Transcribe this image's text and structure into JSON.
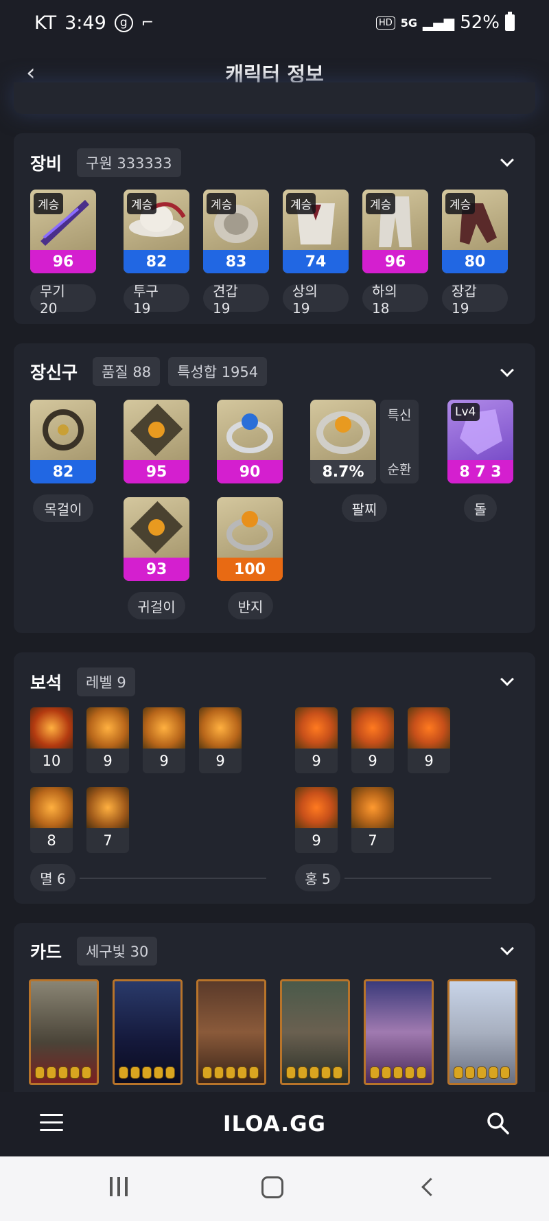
{
  "status_bar": {
    "carrier": "KT",
    "time": "3:49",
    "g_icon": "g",
    "hd": "HD",
    "net": "5G",
    "battery": "52%"
  },
  "header": {
    "title": "캐릭터 정보"
  },
  "equipment": {
    "title": "장비",
    "chip": "구원 333333",
    "items": [
      {
        "tag": "계승",
        "value": "96",
        "tier": "magenta",
        "label": "무기 20"
      },
      {
        "tag": "계승",
        "value": "82",
        "tier": "blue",
        "label": "투구 19"
      },
      {
        "tag": "계승",
        "value": "83",
        "tier": "blue",
        "label": "견갑 19"
      },
      {
        "tag": "계승",
        "value": "74",
        "tier": "blue",
        "label": "상의 19"
      },
      {
        "tag": "계승",
        "value": "96",
        "tier": "magenta",
        "label": "하의 18"
      },
      {
        "tag": "계승",
        "value": "80",
        "tier": "blue",
        "label": "장갑 19"
      }
    ]
  },
  "accessories": {
    "title": "장신구",
    "chips": [
      "품질 88",
      "특성합 1954"
    ],
    "necklace": {
      "value": "82",
      "label": "목걸이"
    },
    "earrings": [
      {
        "value": "95"
      },
      {
        "value": "93"
      }
    ],
    "earring_label": "귀걸이",
    "rings": [
      {
        "value": "90"
      },
      {
        "value": "100"
      }
    ],
    "ring_label": "반지",
    "bracelet": {
      "value": "8.7%",
      "stat1": "특신",
      "stat2": "순환",
      "label": "팔찌"
    },
    "stone": {
      "level": "Lv4",
      "value": "8 7 3",
      "label": "돌"
    }
  },
  "gems": {
    "title": "보석",
    "chip": "레벨 9",
    "left": [
      "10",
      "9",
      "9",
      "9",
      "8",
      "7"
    ],
    "right": [
      "9",
      "9",
      "9",
      "9",
      "7"
    ],
    "left_label": "멸 6",
    "right_label": "홍 5"
  },
  "cards": {
    "title": "카드",
    "chip": "세구빛 30",
    "count": 6
  },
  "bottom": {
    "logo": "ILOA.GG"
  },
  "colors": {
    "magenta": "#d41fcf",
    "blue": "#2167e3",
    "orange": "#e86a13",
    "bg": "#1b1d24"
  }
}
